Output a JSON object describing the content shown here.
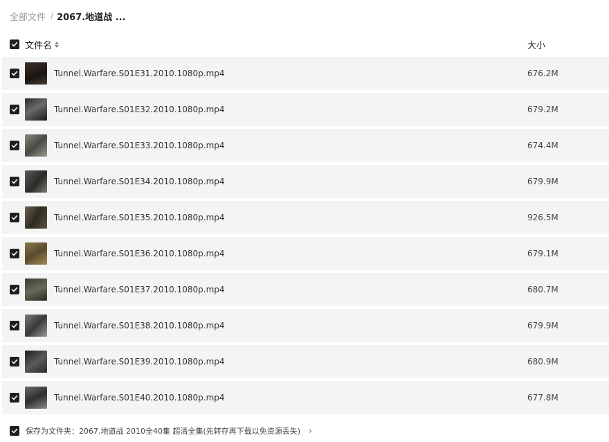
{
  "breadcrumb": {
    "root": "全部文件",
    "separator": "/",
    "current": "2067.地道战 ..."
  },
  "columns": {
    "name": "文件名",
    "size": "大小"
  },
  "files": [
    {
      "name": "Tunnel.Warfare.S01E31.2010.1080p.mp4",
      "size": "676.2M"
    },
    {
      "name": "Tunnel.Warfare.S01E32.2010.1080p.mp4",
      "size": "679.2M"
    },
    {
      "name": "Tunnel.Warfare.S01E33.2010.1080p.mp4",
      "size": "674.4M"
    },
    {
      "name": "Tunnel.Warfare.S01E34.2010.1080p.mp4",
      "size": "679.9M"
    },
    {
      "name": "Tunnel.Warfare.S01E35.2010.1080p.mp4",
      "size": "926.5M"
    },
    {
      "name": "Tunnel.Warfare.S01E36.2010.1080p.mp4",
      "size": "679.1M"
    },
    {
      "name": "Tunnel.Warfare.S01E37.2010.1080p.mp4",
      "size": "680.7M"
    },
    {
      "name": "Tunnel.Warfare.S01E38.2010.1080p.mp4",
      "size": "679.9M"
    },
    {
      "name": "Tunnel.Warfare.S01E39.2010.1080p.mp4",
      "size": "680.9M"
    },
    {
      "name": "Tunnel.Warfare.S01E40.2010.1080p.mp4",
      "size": "677.8M"
    }
  ],
  "footer": {
    "save_text": "保存为文件夹：2067.地道战 2010全40集 超清全集(先转存再下载以免资源丢失)",
    "chevron": "›"
  },
  "colors": {
    "checkbox": "#1f1f1f",
    "row_bg": "#f4f4f4"
  }
}
